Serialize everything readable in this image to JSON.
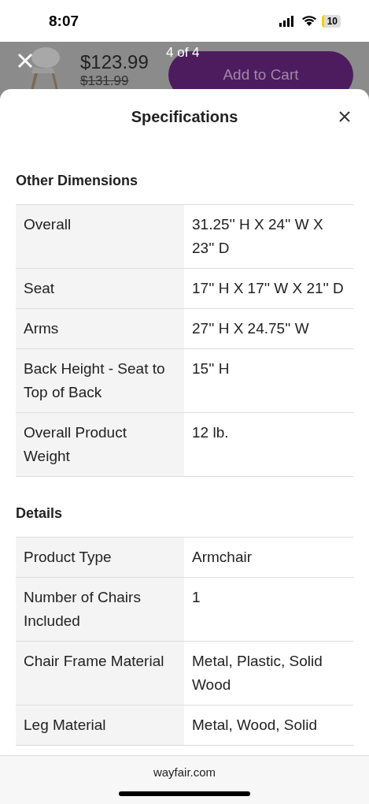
{
  "status_bar": {
    "time": "8:07",
    "battery": "10"
  },
  "product_bar": {
    "price": "$123.99",
    "old_price": "$131.99",
    "counter": "4 of 4",
    "button": "Add to Cart"
  },
  "sheet": {
    "title": "Specifications",
    "sections": [
      {
        "heading": "Other Dimensions",
        "rows": [
          {
            "label": "Overall",
            "value": "31.25'' H X 24'' W X 23'' D"
          },
          {
            "label": "Seat",
            "value": "17'' H X 17'' W X 21'' D"
          },
          {
            "label": "Arms",
            "value": "27'' H X 24.75'' W"
          },
          {
            "label": "Back Height - Seat to Top of Back",
            "value": "15'' H"
          },
          {
            "label": "Overall Product Weight",
            "value": "12 lb."
          }
        ]
      },
      {
        "heading": "Details",
        "rows": [
          {
            "label": "Product Type",
            "value": "Armchair"
          },
          {
            "label": "Number of Chairs Included",
            "value": "1"
          },
          {
            "label": "Chair Frame Material",
            "value": "Metal, Plastic, Solid Wood"
          },
          {
            "label": "Leg Material",
            "value": "Metal, Wood, Solid"
          }
        ]
      }
    ]
  },
  "browser_bar": {
    "url": "wayfair.com"
  }
}
